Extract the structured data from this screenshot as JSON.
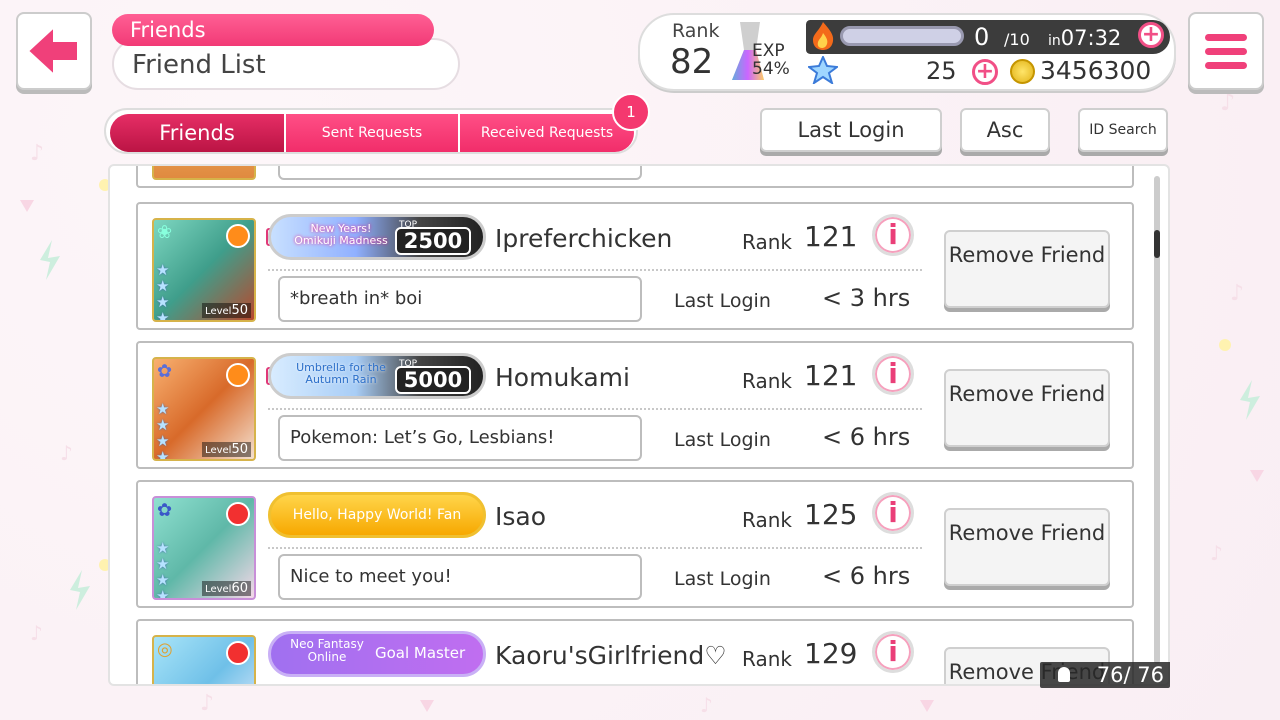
{
  "header": {
    "back_label": "Back",
    "category": "Friends",
    "title": "Friend List"
  },
  "player": {
    "rank_label": "Rank",
    "rank": "82",
    "exp_label": "EXP",
    "exp_percent": "54%",
    "stamina": "0",
    "stamina_max": "/10",
    "stamina_in": "in",
    "stamina_time": "07:32",
    "star_gems": "25",
    "coins": "3456300"
  },
  "tabs": {
    "friends": "Friends",
    "sent": "Sent Requests",
    "received": "Received Requests",
    "received_badge": "1"
  },
  "sort": {
    "last_login": "Last Login",
    "asc": "Asc",
    "id_search": "ID Search"
  },
  "friends": [
    {
      "name": "Ipreferchicken",
      "rank_label": "Rank",
      "rank": "121",
      "title_event": "New Years! Omikuji Madness",
      "title_top": "TOP",
      "title_rank": "2500",
      "comment": "*breath in* boi",
      "last_login_label": "Last Login",
      "last_login": "< 3 hrs",
      "level_label": "Level",
      "level": "50",
      "remove": "Remove Friend"
    },
    {
      "name": "Homukami",
      "rank_label": "Rank",
      "rank": "121",
      "title_event": "Umbrella for the Autumn Rain",
      "title_top": "TOP",
      "title_rank": "5000",
      "comment": "Pokemon: Let’s Go, Lesbians!",
      "last_login_label": "Last Login",
      "last_login": "< 6 hrs",
      "level_label": "Level",
      "level": "50",
      "remove": "Remove Friend"
    },
    {
      "name": "Isao",
      "rank_label": "Rank",
      "rank": "125",
      "title_event": "Hello, Happy World! Fan",
      "comment": "Nice to meet you!",
      "last_login_label": "Last Login",
      "last_login": "< 6 hrs",
      "level_label": "Level",
      "level": "60",
      "remove": "Remove Friend"
    },
    {
      "name": "Kaoru'sGirlfriend♡",
      "rank_label": "Rank",
      "rank": "129",
      "title_event": "Neo Fantasy Online",
      "title_goal": "Goal Master",
      "remove": "Remove Friend"
    }
  ],
  "friend_count": "76/ 76",
  "colors": {
    "accent": "#f23a76",
    "tab_active": "#bb1444",
    "panel_dark": "#3c3c3c"
  }
}
